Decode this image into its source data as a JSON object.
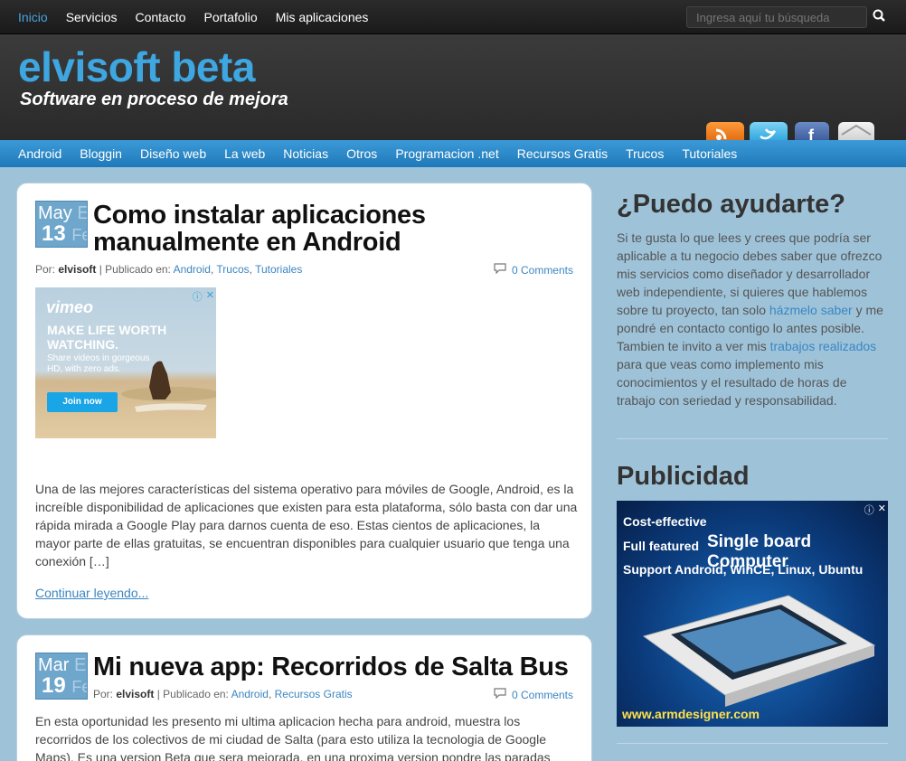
{
  "top_nav": {
    "items": [
      "Inicio",
      "Servicios",
      "Contacto",
      "Portafolio",
      "Mis aplicaciones"
    ],
    "active_index": 0
  },
  "search": {
    "placeholder": "Ingresa aquí tu búsqueda"
  },
  "header": {
    "site_title": "elvisoft beta",
    "tagline": "Software en proceso de mejora",
    "social_icons": [
      "rss-icon",
      "twitter-icon",
      "facebook-icon",
      "email-icon"
    ]
  },
  "category_nav": [
    "Android",
    "Bloggin",
    "Diseño web",
    "La web",
    "Noticias",
    "Otros",
    "Programacion .net",
    "Recursos Gratis",
    "Trucos",
    "Tutoriales"
  ],
  "posts": [
    {
      "date": {
        "month": "May",
        "day": "13",
        "month_ghost": "En",
        "day_ghost": "Fe"
      },
      "title": "Como instalar aplicaciones manualmente en Android",
      "meta": {
        "by_label": "Por:",
        "author": "elvisoft",
        "published_label": "Publicado en:",
        "categories": [
          "Android",
          "Trucos",
          "Tutoriales"
        ]
      },
      "comments": "0 Comments",
      "ad": {
        "logo": "vimeo",
        "headline": "MAKE LIFE WORTH WATCHING.",
        "sub": "Share videos in gorgeous HD, with zero ads.",
        "button": "Join now"
      },
      "excerpt": "Una de las mejores características del sistema operativo para móviles de Google, Android, es la increíble disponibilidad de aplicaciones que existen para esta plataforma, sólo basta con dar una rápida mirada a Google Play para darnos cuenta de eso. Estas cientos de aplicaciones, la mayor parte de ellas gratuitas, se encuentran disponibles para cualquier usuario que tenga una conexión […]",
      "read_more": "Continuar leyendo..."
    },
    {
      "date": {
        "month": "Mar",
        "day": "19",
        "month_ghost": "En",
        "day_ghost": "Fe"
      },
      "title": "Mi nueva app: Recorridos de Salta Bus",
      "meta": {
        "by_label": "Por:",
        "author": "elvisoft",
        "published_label": "Publicado en:",
        "categories": [
          "Android",
          "Recursos Gratis"
        ]
      },
      "comments": "0 Comments",
      "excerpt": "En esta oportunidad les presento mi ultima aplicacion hecha para android, muestra los recorridos de los colectivos de mi ciudad de Salta (para esto utiliza la tecnologia de Google Maps). Es una version Beta que sera mejorada, en una proxima version pondre las paradas"
    }
  ],
  "sidebar": {
    "help_title": "¿Puedo ayudarte?",
    "help_text_1": "Si te gusta lo que lees y crees que podría ser aplicable a tu negocio debes saber que ofrezco mis servicios como diseñador y desarrollador web independiente, si quieres que hablemos sobre tu proyecto, tan solo",
    "help_link_1": "házmelo saber",
    "help_text_2": "y me pondré en contacto contigo lo antes posible. Tambien te invito a ver mis",
    "help_link_2": "trabajos realizados",
    "help_text_3": "para que veas como implemento mis conocimientos y el resultado de horas de trabajo con seriedad y responsabilidad.",
    "ads_title": "Publicidad",
    "ad": {
      "line1": "Cost-effective",
      "line2": "Full featured",
      "big": "Single board Computer",
      "line3": "Support Android, WinCE, Linux, Ubuntu",
      "url": "www.armdesigner.com"
    }
  }
}
